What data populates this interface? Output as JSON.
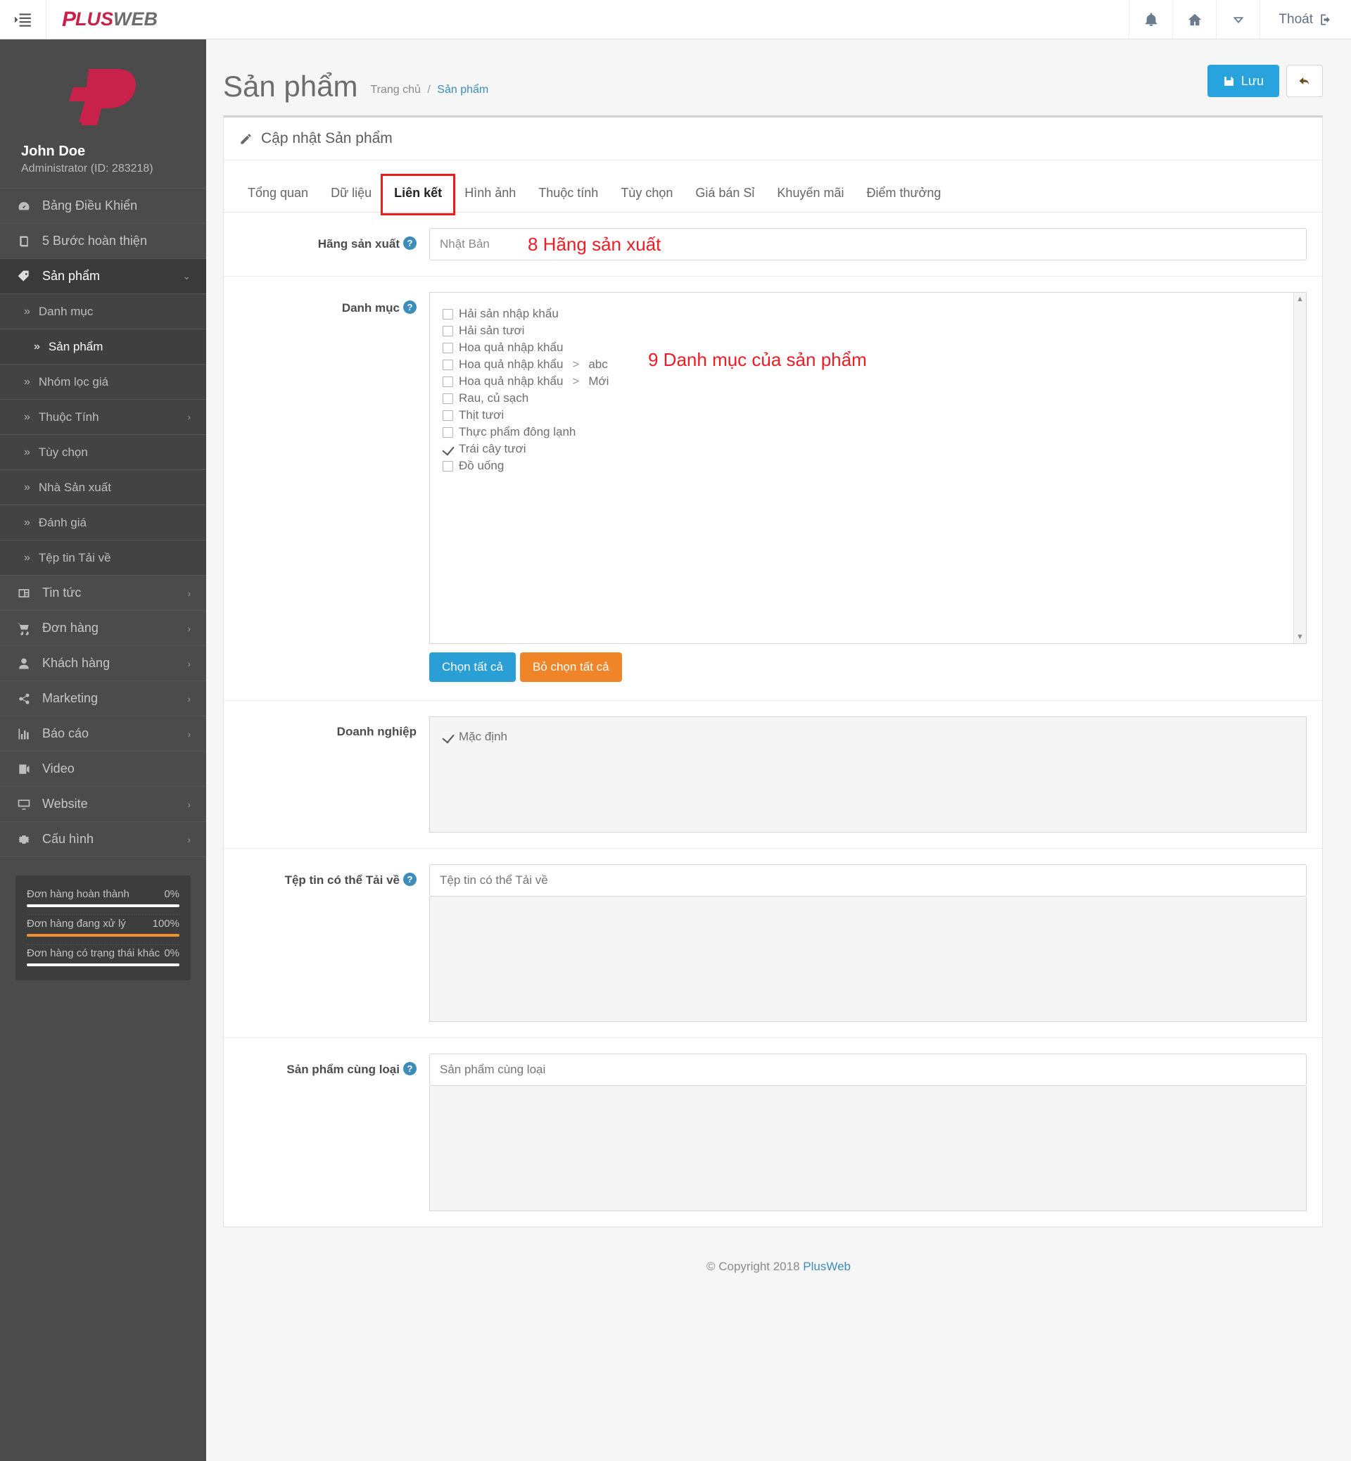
{
  "topbar": {
    "toggle_icon": "sidebar-toggle-icon",
    "logo_p": "P",
    "logo_lus": "LUS",
    "logo_web": "WEB",
    "bell_icon": "bell-icon",
    "home_icon": "home-icon",
    "chevron_icon": "chevron-down-icon",
    "exit_label": "Thoát",
    "exit_icon": "logout-icon"
  },
  "sidebar": {
    "user_name": "John Doe",
    "user_role": "Administrator (ID: 283218)",
    "items": [
      {
        "label": "Bảng Điều Khiển",
        "icon": "dashboard-icon"
      },
      {
        "label": "5 Bước hoàn thiện",
        "icon": "book-icon"
      },
      {
        "label": "Sản phẩm",
        "icon": "tag-icon",
        "caret": "⌄"
      }
    ],
    "sub_items": [
      {
        "label": "Danh mục"
      },
      {
        "label": "Sản phẩm"
      },
      {
        "label": "Nhóm lọc giá"
      },
      {
        "label": "Thuộc Tính",
        "caret": "›"
      },
      {
        "label": "Tùy chọn"
      },
      {
        "label": "Nhà Sản xuất"
      },
      {
        "label": "Đánh giá"
      },
      {
        "label": "Tệp tin Tải về"
      }
    ],
    "items2": [
      {
        "label": "Tin tức",
        "icon": "news-icon",
        "caret": "›"
      },
      {
        "label": "Đơn hàng",
        "icon": "cart-icon",
        "caret": "›"
      },
      {
        "label": "Khách hàng",
        "icon": "user-icon",
        "caret": "›"
      },
      {
        "label": "Marketing",
        "icon": "share-icon",
        "caret": "›"
      },
      {
        "label": "Báo cáo",
        "icon": "chart-icon",
        "caret": "›"
      },
      {
        "label": "Video",
        "icon": "video-icon"
      },
      {
        "label": "Website",
        "icon": "monitor-icon",
        "caret": "›"
      },
      {
        "label": "Cấu hình",
        "icon": "gear-icon",
        "caret": "›"
      }
    ],
    "progress": [
      {
        "label": "Đơn hàng hoàn thành",
        "value": "0%",
        "pct": 100,
        "color": "#ffffff"
      },
      {
        "label": "Đơn hàng đang xử lý",
        "value": "100%",
        "pct": 100,
        "color": "#f0902c"
      },
      {
        "label": "Đơn hàng có trạng thái khác",
        "value": "0%",
        "pct": 100,
        "color": "#ffffff"
      }
    ]
  },
  "page": {
    "title": "Sản phẩm",
    "crumb_home": "Trang chủ",
    "crumb_sep": "/",
    "crumb_current": "Sản phẩm",
    "save_label": "Lưu",
    "save_icon": "floppy-disk-icon",
    "back_icon": "back-arrow-icon"
  },
  "panel": {
    "heading": "Cập nhật Sản phẩm",
    "heading_icon": "pencil-icon",
    "tabs": [
      {
        "label": "Tổng quan",
        "active": false
      },
      {
        "label": "Dữ liệu",
        "active": false
      },
      {
        "label": "Liên kết",
        "active": true
      },
      {
        "label": "Hình ảnh",
        "active": false
      },
      {
        "label": "Thuộc tính",
        "active": false
      },
      {
        "label": "Tùy chọn",
        "active": false
      },
      {
        "label": "Giá bán Sỉ",
        "active": false
      },
      {
        "label": "Khuyến mãi",
        "active": false
      },
      {
        "label": "Điểm thưởng",
        "active": false
      }
    ]
  },
  "form": {
    "manufacturer": {
      "label": "Hãng sản xuất",
      "help": "?",
      "value": "Nhật Bản",
      "annotation": "8 Hãng sản xuất"
    },
    "category": {
      "label": "Danh mục",
      "help": "?",
      "annotation": "9 Danh mục của sản phẩm",
      "options": [
        {
          "label": "Hải sản nhập khẩu",
          "checked": false
        },
        {
          "label": "Hải sản tươi",
          "checked": false
        },
        {
          "label": "Hoa quả nhập khẩu",
          "checked": false
        },
        {
          "label": "Hoa quả nhập khẩu",
          "sub": "abc",
          "checked": false
        },
        {
          "label": "Hoa quả nhập khẩu",
          "sub": "Mới",
          "checked": false
        },
        {
          "label": "Rau, củ sạch",
          "checked": false
        },
        {
          "label": "Thịt tươi",
          "checked": false
        },
        {
          "label": "Thực phẩm đông lạnh",
          "checked": false
        },
        {
          "label": "Trái cây tươi",
          "checked": true
        },
        {
          "label": "Đồ uống",
          "checked": false
        }
      ],
      "select_all": "Chọn tất cả",
      "unselect_all": "Bỏ chọn tất cả"
    },
    "business": {
      "label": "Doanh nghiệp",
      "options": [
        {
          "label": "Mặc định",
          "checked": true
        }
      ]
    },
    "downloads": {
      "label": "Tệp tin có thể Tải về",
      "help": "?",
      "placeholder": "Tệp tin có thể Tải về"
    },
    "related": {
      "label": "Sản phẩm cùng loại",
      "help": "?",
      "placeholder": "Sản phẩm cùng loại"
    }
  },
  "footer": {
    "copyright": "© Copyright 2018",
    "brand": "PlusWeb"
  }
}
